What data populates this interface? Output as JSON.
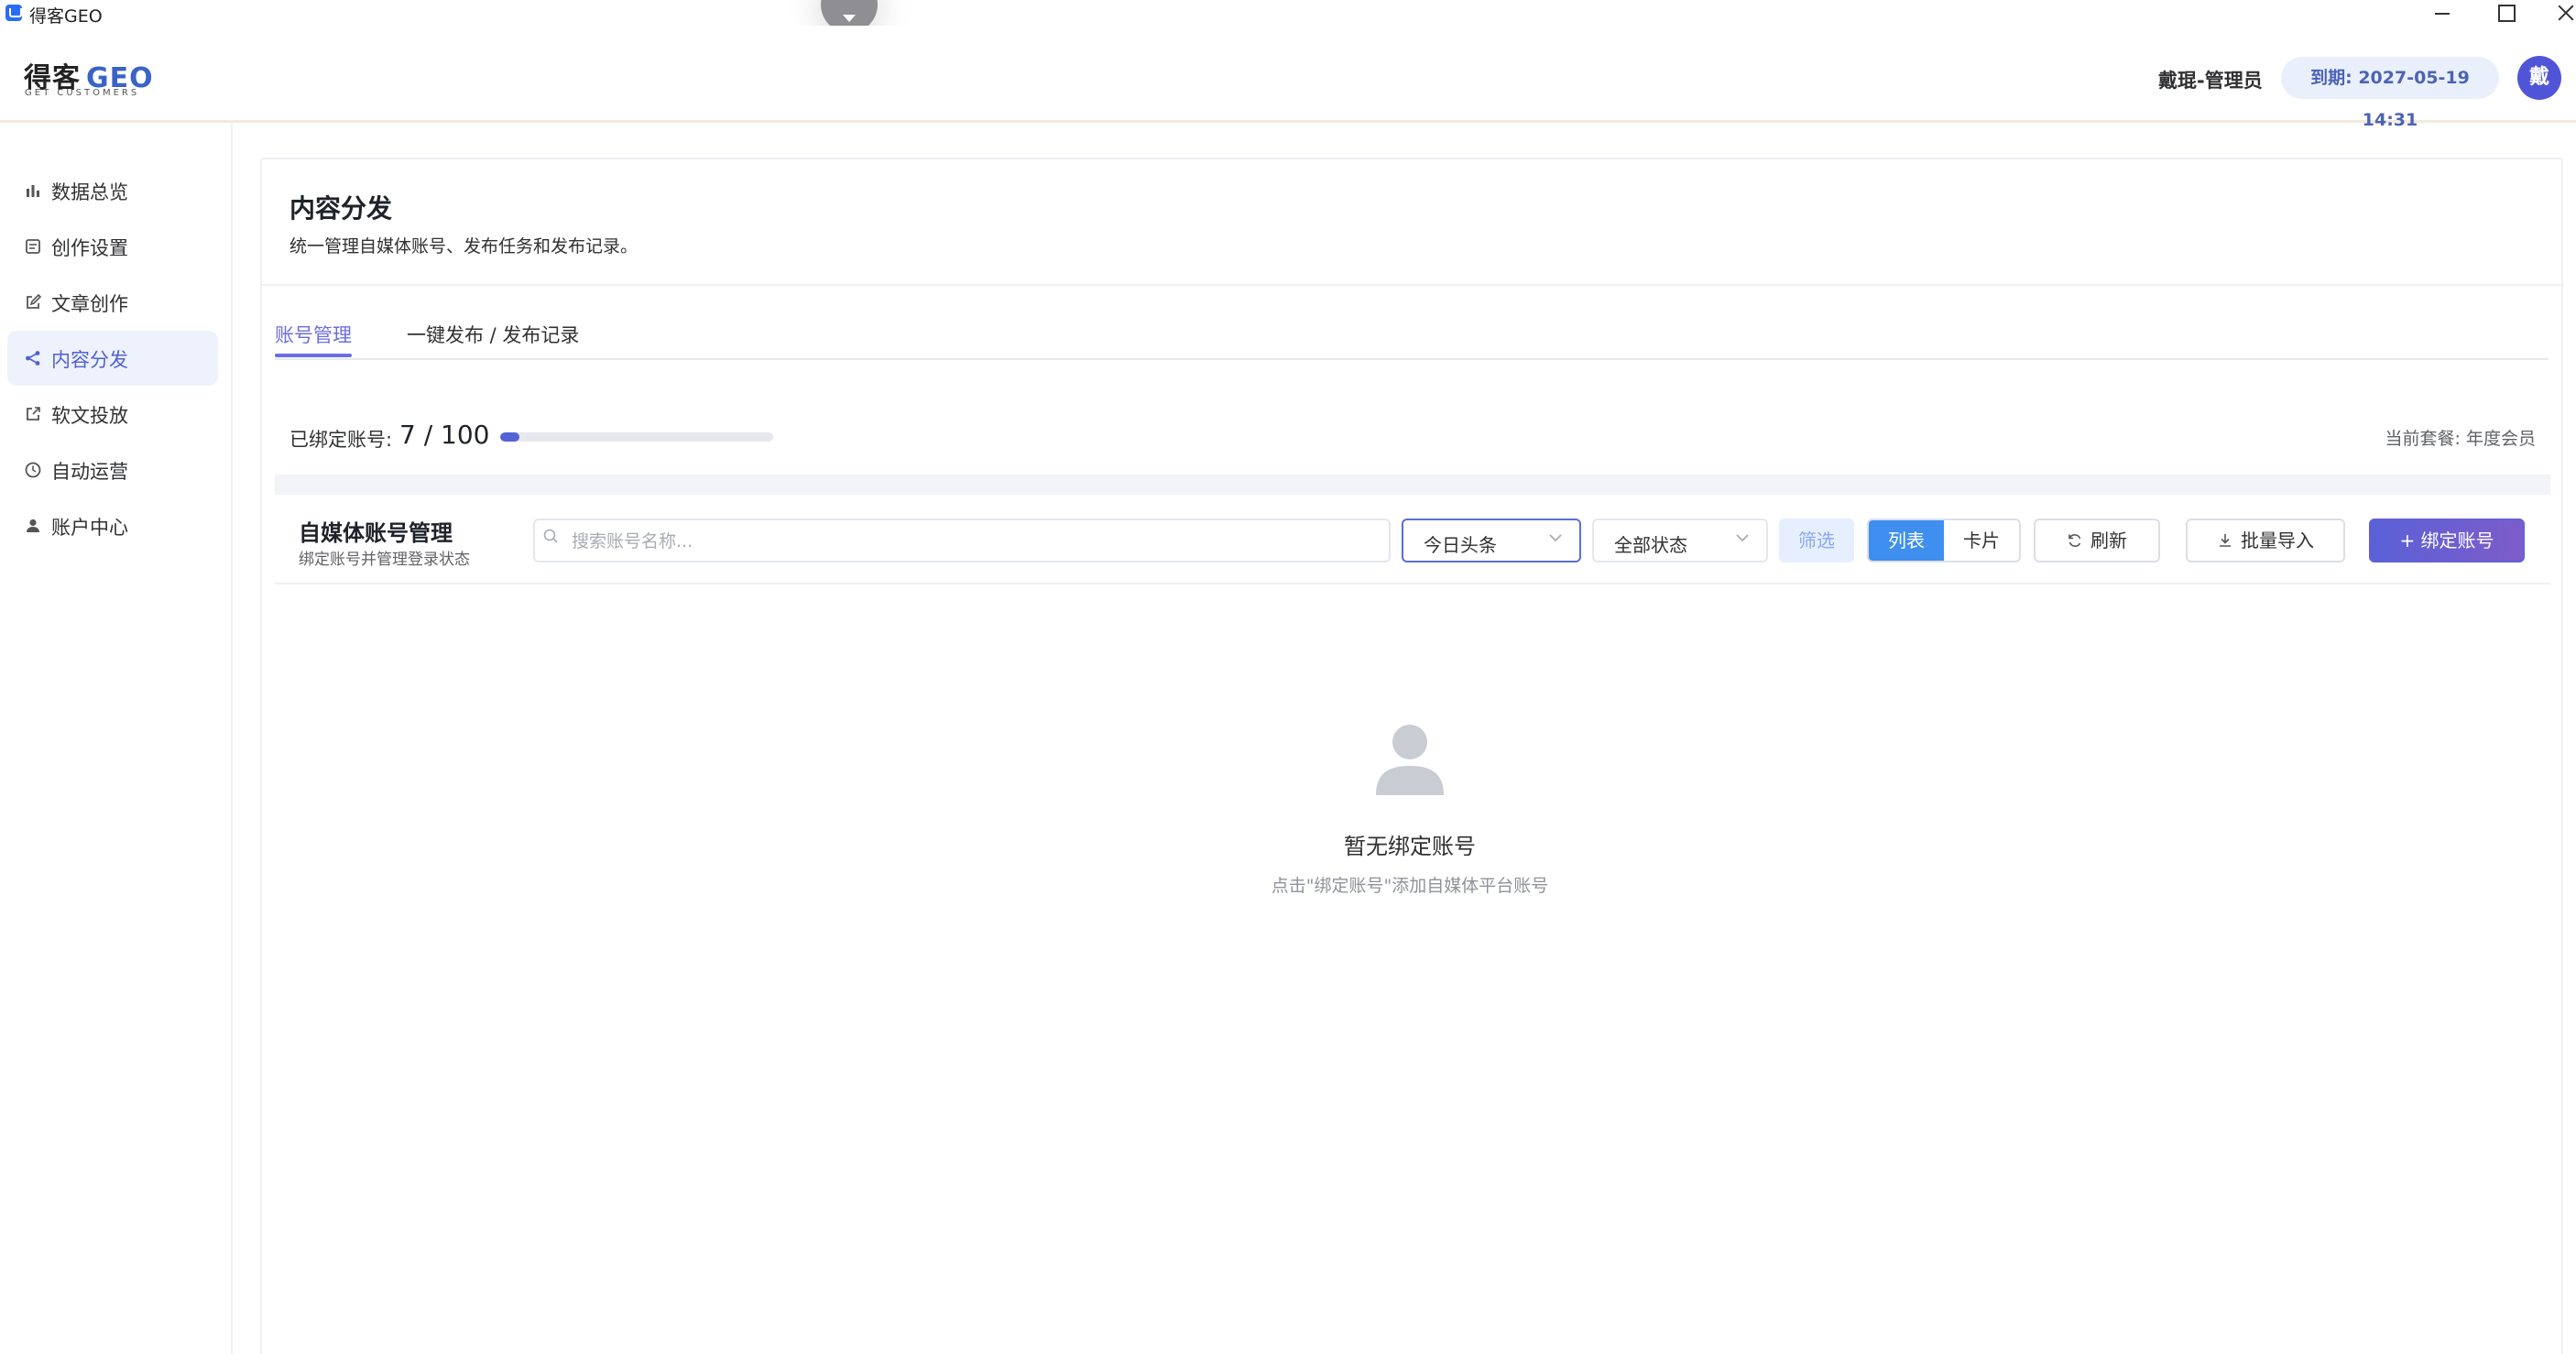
{
  "window": {
    "title": "得客GEO"
  },
  "header": {
    "logo_main": "得客",
    "logo_geo": "GEO",
    "logo_sub": "GET CUSTOMERS",
    "user_name": "戴琨-管理员",
    "expire_text": "到期: 2027-05-19 14:31",
    "avatar_text": "戴"
  },
  "sidebar": {
    "items": [
      {
        "label": "数据总览",
        "icon": "bar-chart-icon",
        "active": false
      },
      {
        "label": "创作设置",
        "icon": "document-settings-icon",
        "active": false
      },
      {
        "label": "文章创作",
        "icon": "edit-icon",
        "active": false
      },
      {
        "label": "内容分发",
        "icon": "share-icon",
        "active": true
      },
      {
        "label": "软文投放",
        "icon": "external-link-icon",
        "active": false
      },
      {
        "label": "自动运营",
        "icon": "clock-icon",
        "active": false
      },
      {
        "label": "账户中心",
        "icon": "user-icon",
        "active": false
      }
    ]
  },
  "main": {
    "title": "内容分发",
    "description": "统一管理自媒体账号、发布任务和发布记录。",
    "tabs": [
      {
        "label": "账号管理",
        "active": true
      },
      {
        "label": "一键发布 / 发布记录",
        "active": false
      }
    ],
    "bound": {
      "label": "已绑定账号:",
      "count_text": "7 / 100",
      "used": 7,
      "total": 100
    },
    "plan_text": "当前套餐: 年度会员",
    "toolbar": {
      "title": "自媒体账号管理",
      "subtitle": "绑定账号并管理登录状态",
      "search_placeholder": "搜索账号名称...",
      "search_value": "",
      "platform_select": "今日头条",
      "status_select": "全部状态",
      "filter_label": "筛选",
      "view_list_label": "列表",
      "view_card_label": "卡片",
      "refresh_label": "刷新",
      "import_label": "批量导入",
      "bind_label": "+ 绑定账号"
    },
    "empty": {
      "title": "暂无绑定账号",
      "hint": "点击\"绑定账号\"添加自媒体平台账号"
    }
  },
  "colors": {
    "accent": "#5a61d8",
    "tab_active": "#6a6ee0",
    "list_toggle": "#3e8ff0",
    "expire_badge_bg": "#eaf0fb",
    "sidebar_active_bg": "#eef2fc"
  }
}
